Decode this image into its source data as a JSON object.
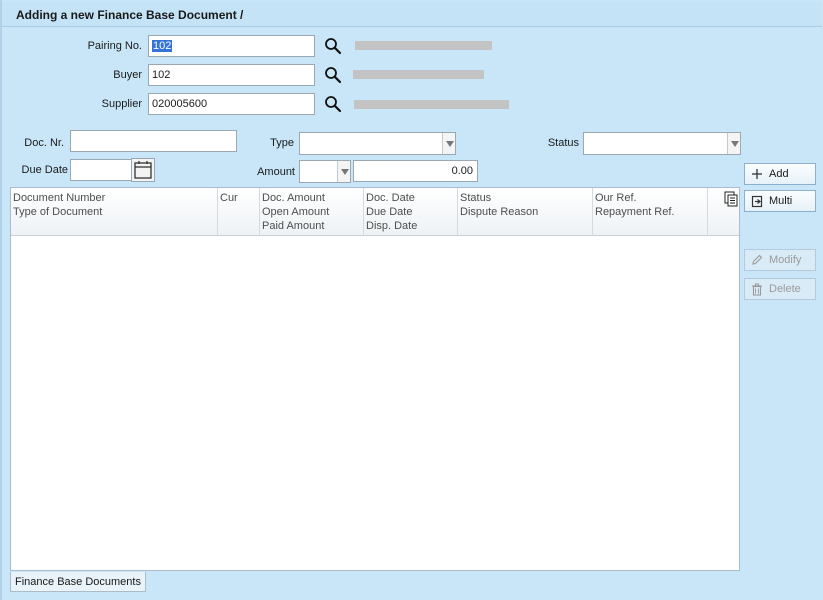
{
  "window": {
    "title": "Adding a new Finance Base Document /"
  },
  "header_fields": {
    "pairing": {
      "label": "Pairing No.",
      "value": "102"
    },
    "buyer": {
      "label": "Buyer",
      "value": "102"
    },
    "supplier": {
      "label": "Supplier",
      "value": "020005600"
    }
  },
  "filters": {
    "doc_nr": {
      "label": "Doc. Nr.",
      "value": ""
    },
    "type": {
      "label": "Type",
      "value": ""
    },
    "status": {
      "label": "Status",
      "value": ""
    },
    "due_date": {
      "label": "Due Date",
      "value": ""
    },
    "amount": {
      "label": "Amount",
      "currency": "",
      "value": "0.00"
    }
  },
  "table": {
    "columns": [
      {
        "lines": [
          "Document Number",
          "Type of Document"
        ]
      },
      {
        "lines": [
          "Cur"
        ]
      },
      {
        "lines": [
          "Doc. Amount",
          "Open Amount",
          "Paid Amount"
        ]
      },
      {
        "lines": [
          "Doc. Date",
          "Due Date",
          "Disp. Date"
        ]
      },
      {
        "lines": [
          "Status",
          "Dispute Reason"
        ]
      },
      {
        "lines": [
          "Our Ref.",
          "Repayment Ref."
        ]
      }
    ]
  },
  "buttons": {
    "add": "Add",
    "multi": "Multi",
    "modify": "Modify",
    "delete": "Delete"
  },
  "tabs": {
    "finance_base_documents": "Finance Base Documents"
  },
  "icons": [
    "search-icon",
    "calendar-icon",
    "plus-icon",
    "multi-icon",
    "pencil-icon",
    "trash-icon",
    "document-list-icon"
  ],
  "colors": {
    "background": "#c9e6f8",
    "selection": "#3473d8"
  }
}
